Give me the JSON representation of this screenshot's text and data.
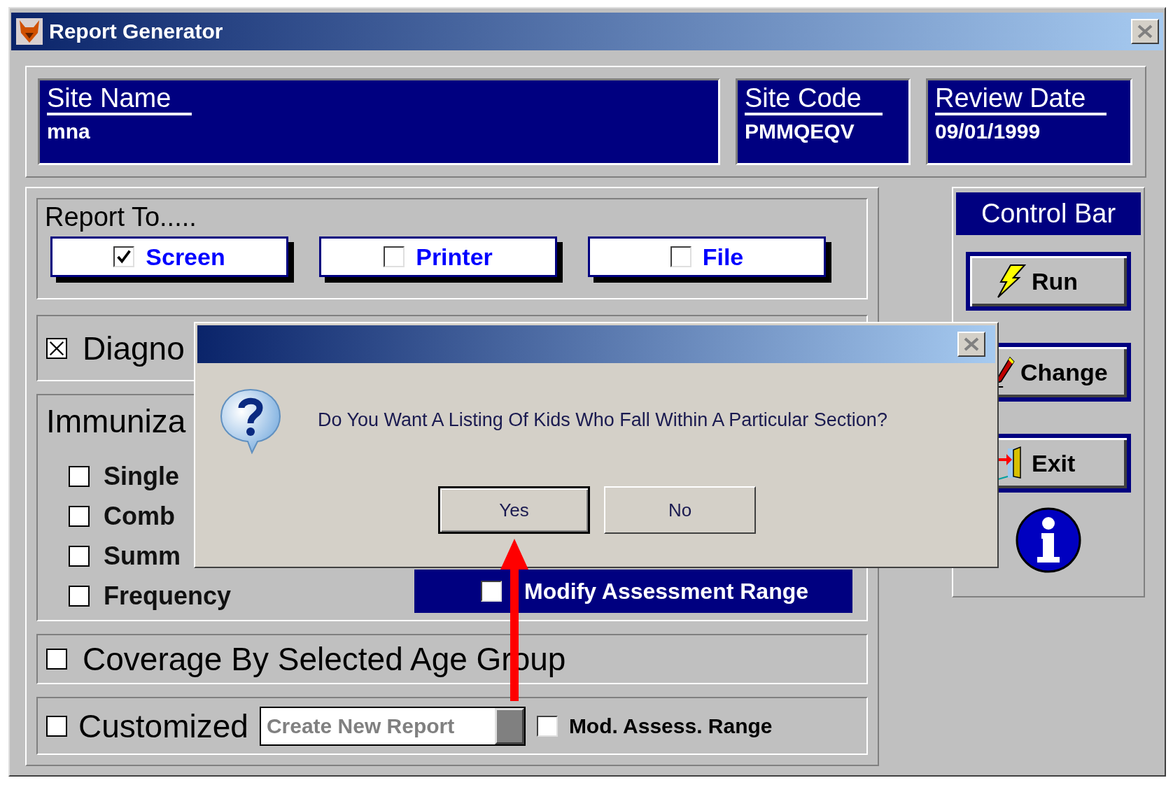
{
  "window": {
    "title": "Report Generator"
  },
  "site_info": [
    {
      "label": "Site Name",
      "value": "mna"
    },
    {
      "label": "Site Code",
      "value": "PMMQEQV"
    },
    {
      "label": "Review Date",
      "value": "09/01/1999"
    }
  ],
  "report_to": {
    "label": "Report To.....",
    "options": [
      {
        "label": "Screen",
        "checked": true
      },
      {
        "label": "Printer",
        "checked": false
      },
      {
        "label": "File",
        "checked": false
      }
    ]
  },
  "diagnostic": {
    "label": "Diagno",
    "checked": true
  },
  "immunization": {
    "title": "Immuniza",
    "options": [
      {
        "label": "Single",
        "checked": false
      },
      {
        "label": "Comb",
        "checked": false
      },
      {
        "label": "Summ",
        "checked": false
      },
      {
        "label": "Frequency",
        "checked": false
      }
    ],
    "modify_range": {
      "label": "Modify Assessment Range",
      "checked": false
    }
  },
  "coverage": {
    "label": "Coverage By Selected Age Group",
    "checked": false
  },
  "customized": {
    "label": "Customized",
    "checked": false,
    "report_field": {
      "placeholder": "Create New Report"
    },
    "mod_range": {
      "label": "Mod. Assess. Range",
      "checked": false
    }
  },
  "control_bar": {
    "title": "Control Bar",
    "buttons": [
      {
        "label": "Run",
        "kind": "run"
      },
      {
        "label": "Change",
        "kind": "change"
      },
      {
        "label": "Exit",
        "kind": "exit"
      }
    ]
  },
  "dialog": {
    "message": "Do You Want A Listing Of Kids Who Fall Within A Particular Section?",
    "buttons": [
      {
        "label": "Yes",
        "selected": true
      },
      {
        "label": "No",
        "selected": false
      }
    ]
  }
}
